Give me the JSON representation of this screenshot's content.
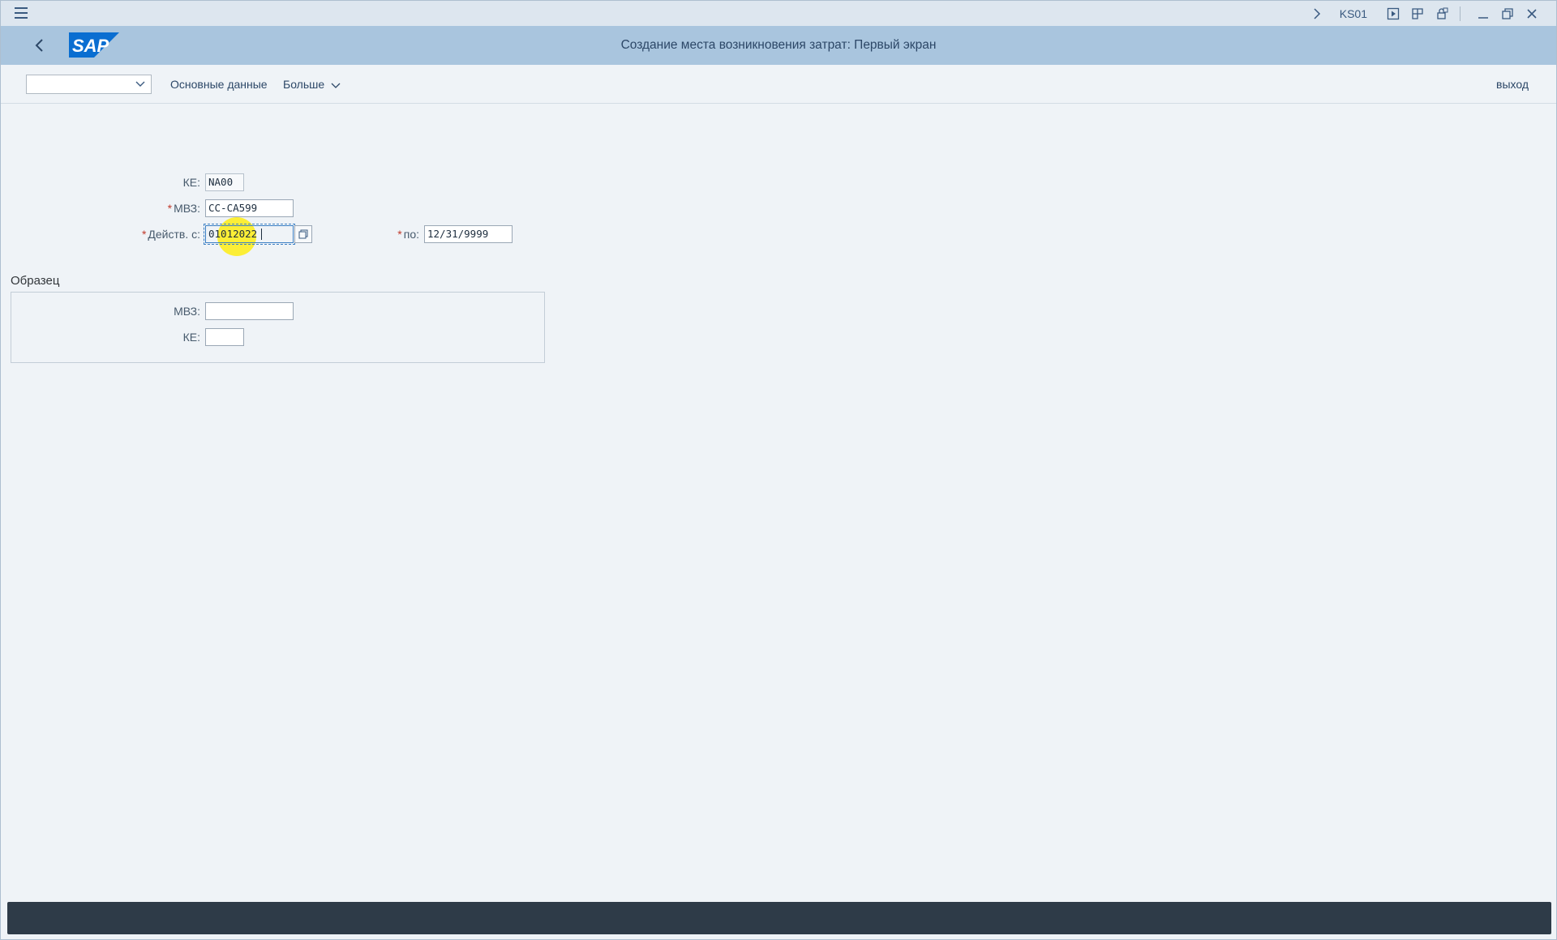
{
  "system_bar": {
    "transaction_code": "KS01",
    "icons": [
      "menu-icon",
      "chevron-right-icon",
      "execute-icon",
      "layout-icon",
      "lock-icon",
      "minimize-icon",
      "restore-icon",
      "close-icon"
    ]
  },
  "title_bar": {
    "title": "Создание места возникновения затрат: Первый экран",
    "logo_text": "SAP",
    "colors": {
      "title_bar": "#a9c5de",
      "logo": "#0a6ed1"
    }
  },
  "toolbar": {
    "dropdown_value": "",
    "master_data_label": "Основные данные",
    "more_label": "Больше",
    "exit_label": "выход"
  },
  "form": {
    "ke_label": "КЕ:",
    "ke_value": "NA00",
    "mvz_label": "МВЗ:",
    "mvz_value": "CC-CA599",
    "valid_from_label": "Действ. с:",
    "valid_from_value": "01012022",
    "valid_to_label": "по:",
    "valid_to_value": "12/31/9999"
  },
  "template_group": {
    "title": "Образец",
    "mvz_label": "МВЗ:",
    "mvz_value": "",
    "ke_label": "КЕ:",
    "ke_value": ""
  },
  "status_bar": {
    "message": "",
    "color": "#2e3b48"
  }
}
